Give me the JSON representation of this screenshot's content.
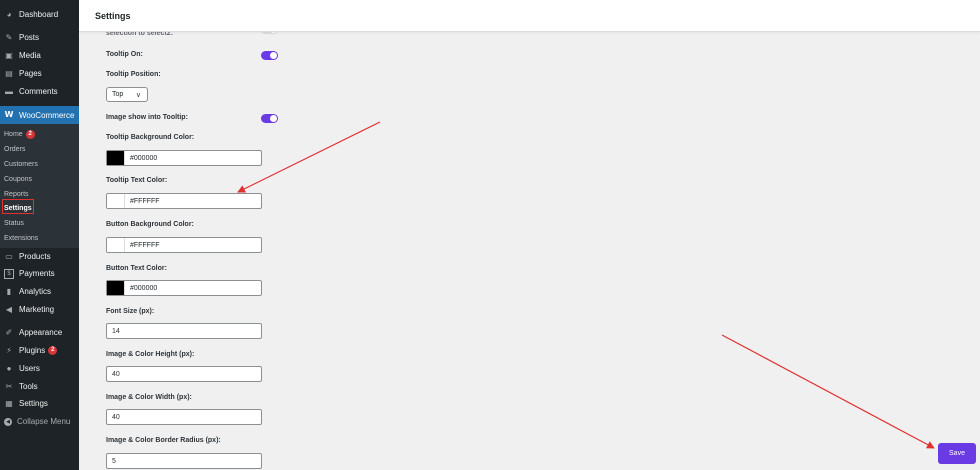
{
  "sidebar": {
    "items": [
      {
        "label": "Dashboard",
        "icon": "dashboard-icon",
        "glyph": "◕"
      },
      {
        "label": "Posts",
        "icon": "pin-icon",
        "glyph": "✎"
      },
      {
        "label": "Media",
        "icon": "media-icon",
        "glyph": "▣"
      },
      {
        "label": "Pages",
        "icon": "pages-icon",
        "glyph": "▤"
      },
      {
        "label": "Comments",
        "icon": "comments-icon",
        "glyph": "▬"
      },
      {
        "label": "WooCommerce",
        "icon": "woocommerce-icon",
        "glyph": "W"
      },
      {
        "label": "Products",
        "icon": "products-icon",
        "glyph": "▭"
      },
      {
        "label": "Payments",
        "icon": "payments-icon",
        "glyph": "$"
      },
      {
        "label": "Analytics",
        "icon": "analytics-icon",
        "glyph": "▮"
      },
      {
        "label": "Marketing",
        "icon": "marketing-icon",
        "glyph": "◀"
      },
      {
        "label": "Appearance",
        "icon": "appearance-icon",
        "glyph": "✐"
      },
      {
        "label": "Plugins",
        "icon": "plugins-icon",
        "glyph": "⚡",
        "badge": "2"
      },
      {
        "label": "Users",
        "icon": "users-icon",
        "glyph": "●"
      },
      {
        "label": "Tools",
        "icon": "tools-icon",
        "glyph": "✂"
      },
      {
        "label": "Settings",
        "icon": "settings-icon",
        "glyph": "▦"
      },
      {
        "label": "Collapse Menu",
        "icon": "collapse-icon",
        "glyph": "◀"
      }
    ],
    "submenu": [
      {
        "label": "Home",
        "badge": "2"
      },
      {
        "label": "Orders"
      },
      {
        "label": "Customers"
      },
      {
        "label": "Coupons"
      },
      {
        "label": "Reports"
      },
      {
        "label": "Settings"
      },
      {
        "label": "Status"
      },
      {
        "label": "Extensions"
      }
    ]
  },
  "header": {
    "title": "Settings"
  },
  "form": {
    "cut_label": "selection to select2:",
    "tooltip_on": {
      "label": "Tooltip On:",
      "enabled": true
    },
    "tooltip_position": {
      "label": "Tooltip Position:",
      "value": "Top"
    },
    "image_tooltip": {
      "label": "Image show into Tooltip:",
      "enabled": true
    },
    "tooltip_bg": {
      "label": "Tooltip Background Color:",
      "value": "#000000",
      "swatch": "#000000"
    },
    "tooltip_text": {
      "label": "Tooltip Text Color:",
      "value": "#FFFFFF",
      "swatch": "#FFFFFF"
    },
    "button_bg": {
      "label": "Button Background Color:",
      "value": "#FFFFFF",
      "swatch": "#FFFFFF"
    },
    "button_text": {
      "label": "Button Text Color:",
      "value": "#000000",
      "swatch": "#000000"
    },
    "font_size": {
      "label": "Font Size (px):",
      "value": "14"
    },
    "img_height": {
      "label": "Image & Color Height (px):",
      "value": "40"
    },
    "img_width": {
      "label": "Image & Color Width (px):",
      "value": "40"
    },
    "img_radius": {
      "label": "Image & Color Border Radius (px):",
      "value": "5"
    }
  },
  "save_label": "Save",
  "colors": {
    "accent": "#6a3be4",
    "wp_blue": "#2271b1",
    "annotation": "#e03131"
  }
}
